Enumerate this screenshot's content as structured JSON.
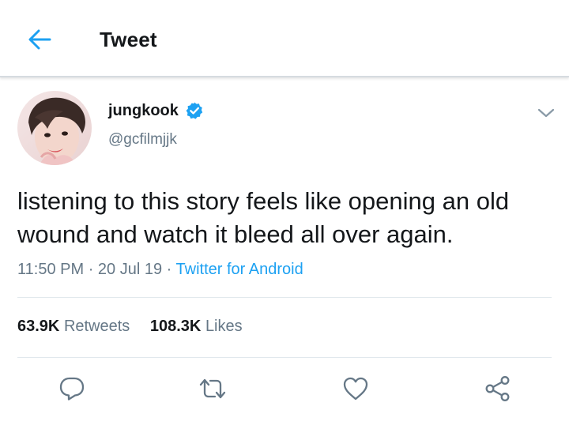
{
  "header": {
    "title": "Tweet",
    "back_icon": "arrow-left-icon",
    "accent_color": "#1da1f2"
  },
  "tweet": {
    "author": {
      "display_name": "jungkook",
      "handle": "@gcfilmjjk",
      "verified": true,
      "verified_icon": "verified-badge-icon"
    },
    "text": "listening to this story feels like opening an old wound and watch it bleed all over again.",
    "time": "11:50 PM",
    "separator": "·",
    "date": "20 Jul 19",
    "source": "Twitter for Android",
    "stats": {
      "retweets_count": "63.9K",
      "retweets_label": "Retweets",
      "likes_count": "108.3K",
      "likes_label": "Likes"
    },
    "actions": [
      "reply-icon",
      "retweet-icon",
      "like-icon",
      "share-icon"
    ]
  },
  "colors": {
    "text_primary": "#14171a",
    "text_secondary": "#657786",
    "link": "#1da1f2",
    "divider": "#e1e8ed"
  }
}
